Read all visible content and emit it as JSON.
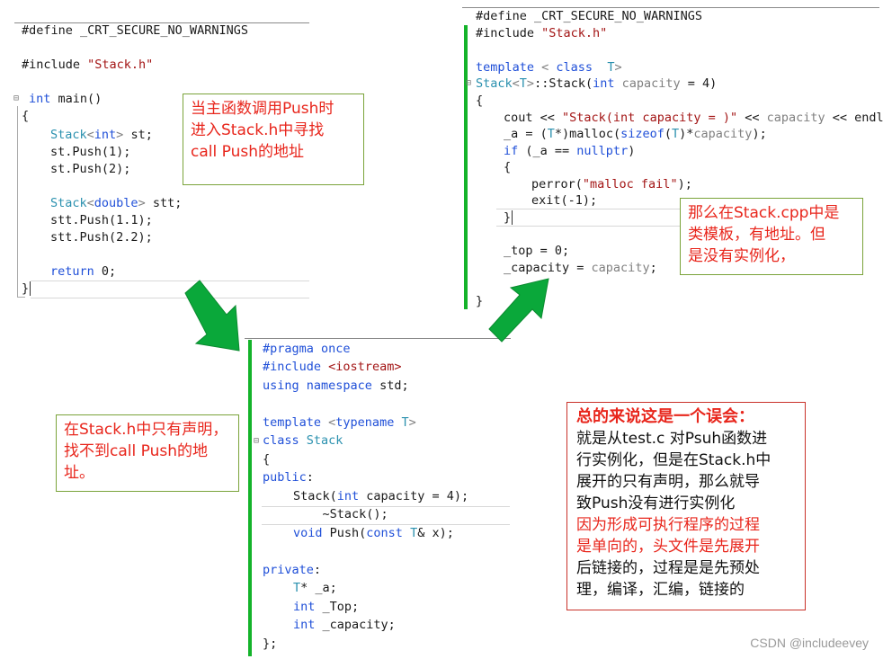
{
  "main_cpp": {
    "lines": [
      "#define _CRT_SECURE_NO_WARNINGS",
      "",
      "#include \"Stack.h\"",
      "",
      "int main()",
      "{",
      "    Stack<int> st;",
      "    st.Push(1);",
      "    st.Push(2);",
      "",
      "    Stack<double> stt;",
      "    stt.Push(1.1);",
      "    stt.Push(2.2);",
      "",
      "    return 0;",
      "}"
    ]
  },
  "stack_cpp": {
    "lines": [
      "#define _CRT_SECURE_NO_WARNINGS",
      "#include \"Stack.h\"",
      "",
      "template < class  T>",
      "Stack<T>::Stack(int capacity = 4)",
      "{",
      "    cout << \"Stack(int capacity = )\" << capacity << endl;",
      "    _a = (T*)malloc(sizeof(T)*capacity);",
      "    if (_a == nullptr)",
      "    {",
      "        perror(\"malloc fail\");",
      "        exit(-1);",
      "    }",
      "",
      "    _top = 0;",
      "    _capacity = capacity;",
      "",
      "}"
    ]
  },
  "stack_h": {
    "lines": [
      "#pragma once",
      "#include <iostream>",
      "using namespace std;",
      "",
      "template <typename T>",
      "class Stack",
      "{",
      "public:",
      "    Stack(int capacity = 4);",
      "    ~Stack();",
      "    void Push(const T& x);",
      "",
      "private:",
      "    T* _a;",
      "    int _Top;",
      "    int _capacity;",
      "};"
    ]
  },
  "notes": {
    "note1": [
      "当主函数调用Push时",
      "进入Stack.h中寻找",
      "call Push的地址"
    ],
    "note2": [
      "那么在Stack.cpp中是",
      "类模板，有地址。但",
      "是没有实例化，"
    ],
    "note3": [
      "在Stack.h中只有声明，",
      "找不到call Push的地",
      "址。"
    ],
    "summary": {
      "title": "总的来说这是一个误会：",
      "black_lines": [
        "就是从test.c 对Psuh函数进",
        "行实例化，但是在Stack.h中",
        "展开的只有声明，那么就导",
        "致Push没有进行实例化"
      ],
      "red_lines": [
        "因为形成可执行程序的过程",
        "是单向的，头文件是先展开",
        "后链接的，过程是是先预处",
        "理，编译，汇编，链接的"
      ]
    }
  },
  "watermark": "CSDN @includeevey",
  "colors": {
    "keyword": "#1f4fd8",
    "type": "#2b91af",
    "string": "#a31515",
    "arrow": "#0aa83a",
    "note_text": "#e8261c",
    "green_bar": "#14b32a"
  }
}
